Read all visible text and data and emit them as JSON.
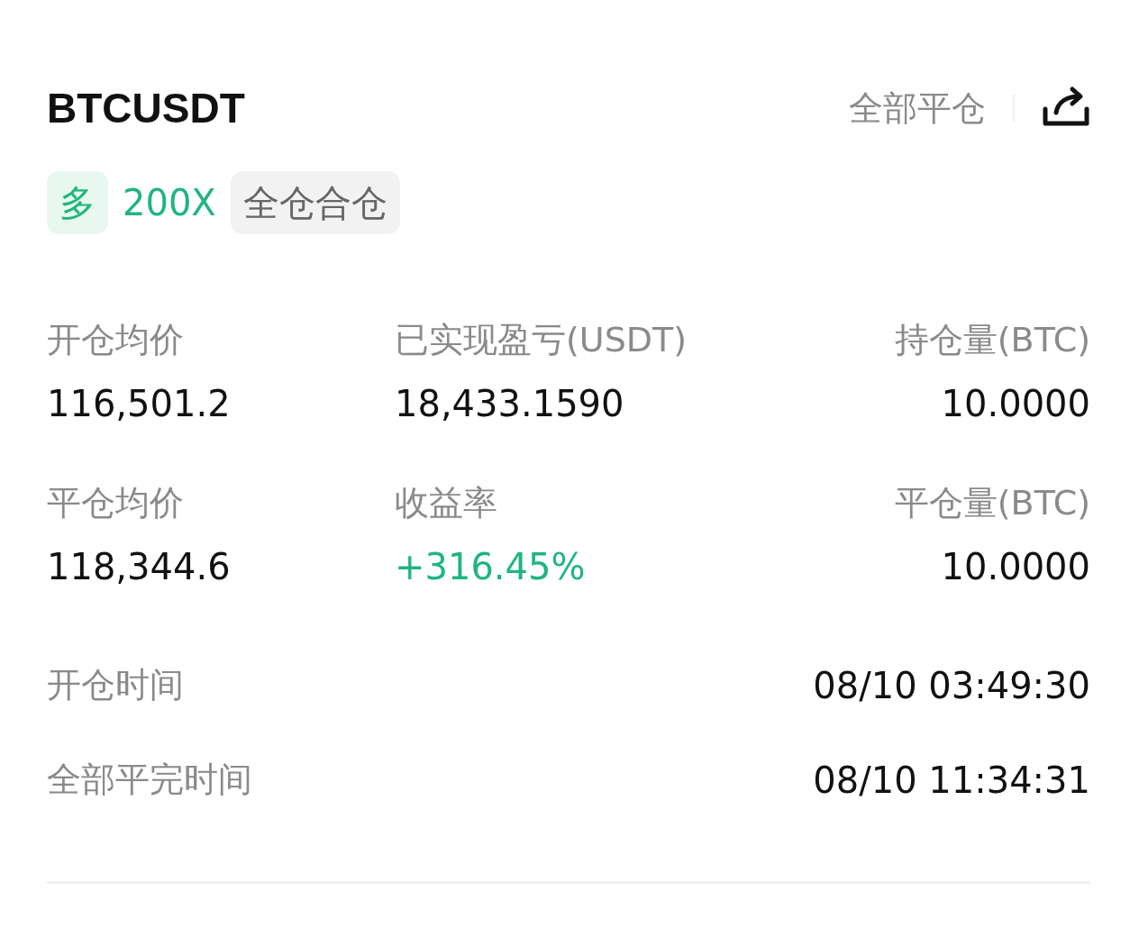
{
  "header": {
    "symbol": "BTCUSDT",
    "close_all": "全部平仓"
  },
  "tags": [
    {
      "kind": "side",
      "text": "多"
    },
    {
      "kind": "leverage",
      "text": "200X"
    },
    {
      "kind": "margin",
      "text": "全仓合仓"
    }
  ],
  "stats": [
    {
      "label": "开仓均价",
      "value": "116,501.2",
      "positive": false
    },
    {
      "label": "已实现盈亏(USDT)",
      "value": "18,433.1590",
      "positive": false
    },
    {
      "label": "持仓量(BTC)",
      "value": "10.0000",
      "positive": false
    },
    {
      "label": "平仓均价",
      "value": "118,344.6",
      "positive": false
    },
    {
      "label": "收益率",
      "value": "+316.45%",
      "positive": true
    },
    {
      "label": "平仓量(BTC)",
      "value": "10.0000",
      "positive": false
    }
  ],
  "times": [
    {
      "label": "开仓时间",
      "value": "08/10 03:49:30"
    },
    {
      "label": "全部平完时间",
      "value": "08/10 11:34:31"
    }
  ]
}
